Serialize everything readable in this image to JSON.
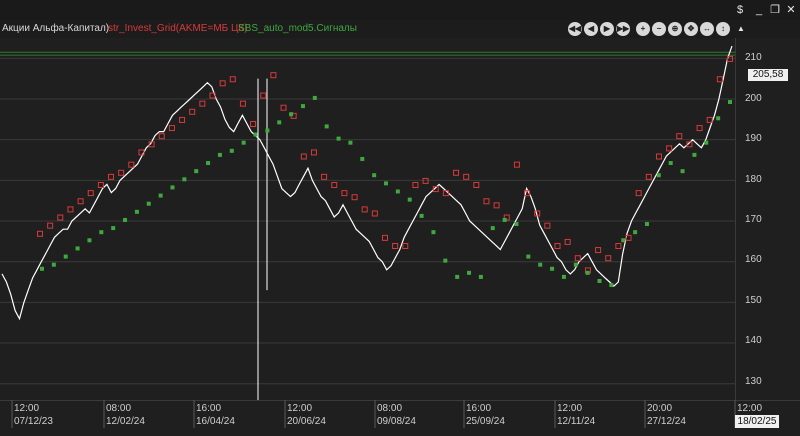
{
  "legend": {
    "instrument": "Акции Альфа-Капитал)",
    "grid_strategy": "str_Invest_Grid(AKME=МБ ЦК)",
    "signal_strategy": "SBS_auto_mod5.Сигналы",
    "grid_color": "#d83a3a",
    "signal_color": "#3fa83f"
  },
  "window": {
    "dollar_icon": "$",
    "minimize_icon": "_",
    "restore_icon": "❐",
    "close_icon": "✕"
  },
  "toolbar": {
    "buttons": [
      "scroll-far-left",
      "scroll-left",
      "scroll-right",
      "scroll-far-right",
      "zoom-in",
      "zoom-out",
      "zoom-fit",
      "move",
      "move-horizontal",
      "move-vertical",
      "collapse"
    ]
  },
  "axis": {
    "price_ticks": [
      "210",
      "200",
      "190",
      "180",
      "170",
      "160",
      "150",
      "140",
      "130"
    ],
    "current_price": "205,58",
    "time_ticks": [
      {
        "time": "12:00",
        "date": "07/12/23"
      },
      {
        "time": "08:00",
        "date": "12/02/24"
      },
      {
        "time": "16:00",
        "date": "16/04/24"
      },
      {
        "time": "12:00",
        "date": "20/06/24"
      },
      {
        "time": "08:00",
        "date": "09/08/24"
      },
      {
        "time": "16:00",
        "date": "25/09/24"
      },
      {
        "time": "12:00",
        "date": "12/11/24"
      },
      {
        "time": "20:00",
        "date": "27/12/24"
      },
      {
        "time": "12:00",
        "date": ""
      }
    ],
    "current_date": "18/02/25"
  },
  "chart_data": {
    "type": "line",
    "ylim": [
      126,
      215
    ],
    "grid": true,
    "series": [
      {
        "y": [
          157,
          155,
          152,
          148,
          146,
          150,
          153,
          156,
          158,
          160,
          162,
          164,
          166,
          167,
          168,
          168,
          170,
          171,
          172,
          173,
          172,
          174,
          176,
          178,
          179,
          177,
          178,
          180,
          181,
          182,
          183,
          184,
          186,
          188,
          189,
          191,
          192,
          192,
          194,
          196,
          197,
          198,
          199,
          200,
          201,
          202,
          203,
          204,
          203,
          200,
          198,
          195,
          193,
          192,
          194,
          196,
          194,
          192,
          191,
          190,
          188,
          186,
          184,
          181,
          178,
          177,
          176,
          177,
          179,
          181,
          183,
          180,
          178,
          176,
          175,
          173,
          171,
          172,
          174,
          172,
          170,
          168,
          167,
          166,
          165,
          163,
          161,
          160,
          158,
          159,
          161,
          163,
          166,
          168,
          170,
          172,
          174,
          176,
          177,
          178,
          179,
          178,
          177,
          176,
          175,
          174,
          172,
          170,
          169,
          168,
          167,
          166,
          165,
          164,
          163,
          165,
          167,
          169,
          171,
          173,
          178,
          176,
          173,
          169,
          167,
          165,
          163,
          161,
          160,
          158,
          157,
          158,
          160,
          161,
          162,
          160,
          158,
          157,
          156,
          155,
          154,
          155,
          162,
          167,
          170,
          172,
          174,
          176,
          178,
          180,
          182,
          184,
          186,
          187,
          188,
          189,
          188,
          189,
          190,
          189,
          188,
          190,
          193,
          196,
          200,
          205,
          210,
          213
        ]
      }
    ],
    "grid_orders": [
      166,
      168,
      170,
      172,
      174,
      176,
      178,
      180,
      181,
      183,
      186,
      188,
      190,
      192,
      194,
      196,
      198,
      200,
      203,
      204,
      198,
      193,
      200,
      205,
      197,
      195,
      185,
      186,
      180,
      178,
      176,
      175,
      172,
      171,
      165,
      163,
      163,
      178,
      179,
      177,
      176,
      181,
      180,
      178,
      174,
      173,
      170,
      183,
      176,
      171,
      168,
      163,
      164,
      160,
      157,
      162,
      160,
      163,
      165,
      176,
      180,
      185,
      187,
      190,
      188,
      192,
      194,
      204,
      209
    ],
    "signals": [
      159,
      160,
      162,
      164,
      166,
      168,
      169,
      171,
      173,
      175,
      177,
      179,
      181,
      183,
      185,
      187,
      188,
      190,
      192,
      193,
      195,
      197,
      199,
      201,
      194,
      191,
      190,
      186,
      182,
      180,
      178,
      176,
      172,
      168,
      161,
      157,
      158,
      157,
      169,
      171,
      170,
      162,
      160,
      159,
      157,
      160,
      158,
      156,
      155,
      166,
      168,
      170,
      182,
      185,
      183,
      187,
      190,
      196,
      200
    ]
  }
}
